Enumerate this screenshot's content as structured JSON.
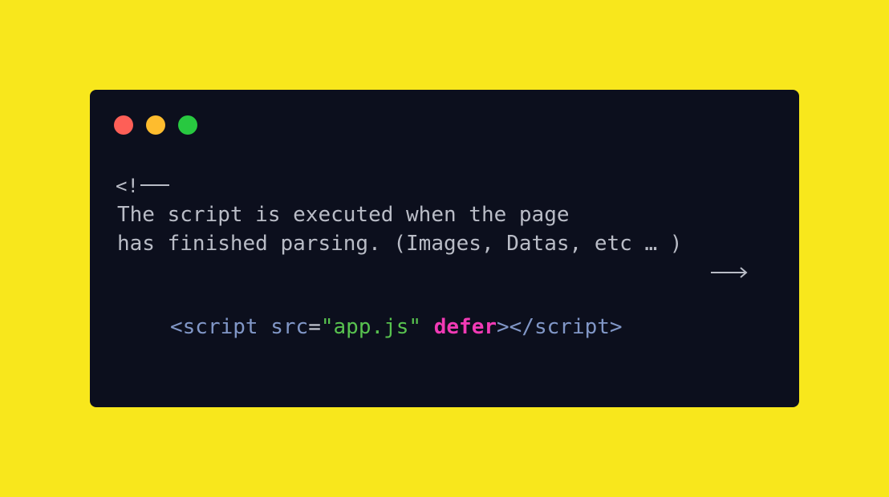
{
  "window": {
    "controls": {
      "close_color": "#fe5f57",
      "minimize_color": "#febc2e",
      "maximize_color": "#28c840"
    }
  },
  "comment": {
    "open": "<!",
    "line1": "The script is executed when the page",
    "line2": "has finished parsing. (Images, Datas, etc … )",
    "close_icon": "long-arrow-right-icon"
  },
  "code": {
    "tag_open": "<script",
    "attr_name": "src",
    "equals": "=",
    "attr_value": "\"app.js\"",
    "keyword": "defer",
    "tag_mid": "></",
    "tag_close": "script>"
  },
  "colors": {
    "background": "#f8e71c",
    "window": "#0c0f1d",
    "comment": "#b9bcc6",
    "tag": "#8197c7",
    "string": "#58c24f",
    "keyword": "#f13ab5"
  }
}
